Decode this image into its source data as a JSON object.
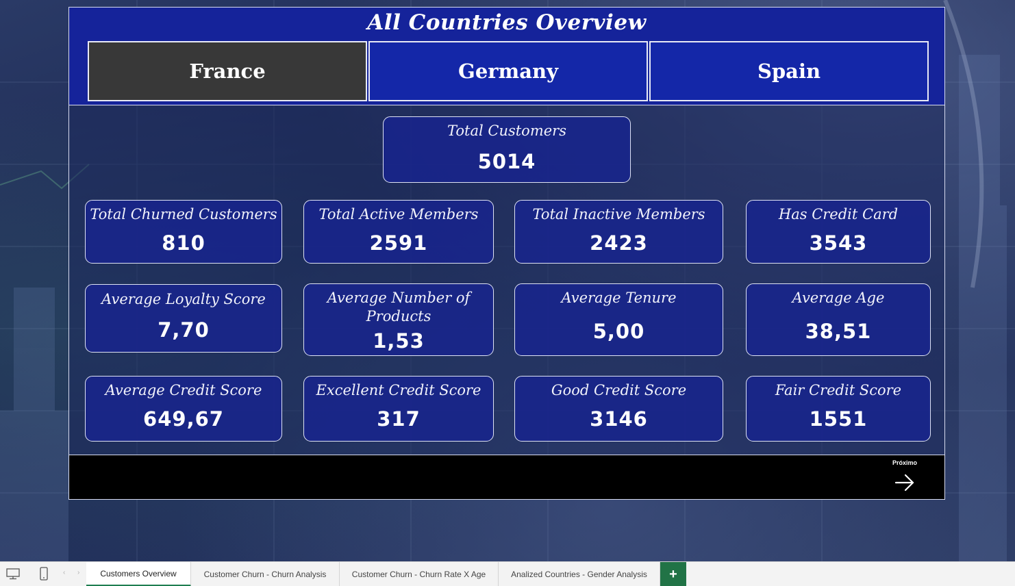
{
  "report": {
    "title": "All Countries Overview",
    "countries": [
      {
        "label": "France",
        "selected": true
      },
      {
        "label": "Germany",
        "selected": false
      },
      {
        "label": "Spain",
        "selected": false
      }
    ]
  },
  "kpis": {
    "total_customers": {
      "label": "Total Customers",
      "value": "5014"
    },
    "total_churned": {
      "label": "Total Churned Customers",
      "value": "810"
    },
    "total_active": {
      "label": "Total Active Members",
      "value": "2591"
    },
    "total_inactive": {
      "label": "Total Inactive Members",
      "value": "2423"
    },
    "has_credit_card": {
      "label": "Has Credit Card",
      "value": "3543"
    },
    "avg_loyalty": {
      "label": "Average Loyalty Score",
      "value": "7,70"
    },
    "avg_products": {
      "label_line1": "Average Number of",
      "label_line2": "Products",
      "value": "1,53"
    },
    "avg_tenure": {
      "label": "Average Tenure",
      "value": "5,00"
    },
    "avg_age": {
      "label": "Average Age",
      "value": "38,51"
    },
    "avg_credit": {
      "label": "Average Credit Score",
      "value": "649,67"
    },
    "excellent_credit": {
      "label": "Excellent Credit Score",
      "value": "317"
    },
    "good_credit": {
      "label": "Good Credit Score",
      "value": "3146"
    },
    "fair_credit": {
      "label": "Fair Credit Score",
      "value": "1551"
    }
  },
  "navigation": {
    "next_label": "Próximo"
  },
  "tabs": [
    {
      "label": "Customers Overview",
      "active": true
    },
    {
      "label": "Customer Churn - Churn Analysis",
      "active": false
    },
    {
      "label": "Customer Churn - Churn Rate X Age",
      "active": false
    },
    {
      "label": "Analized Countries - Gender Analysis",
      "active": false
    }
  ],
  "tabbar": {
    "add_label": "+",
    "prev_glyph": "‹",
    "next_glyph": "›"
  },
  "colors": {
    "header_blue": "#15239a",
    "button_blue": "#1427a8",
    "selected_gray": "#383838",
    "kpi_blue": "#18248c",
    "tab_accent": "#1e7e50",
    "add_tab_green": "#217346"
  }
}
